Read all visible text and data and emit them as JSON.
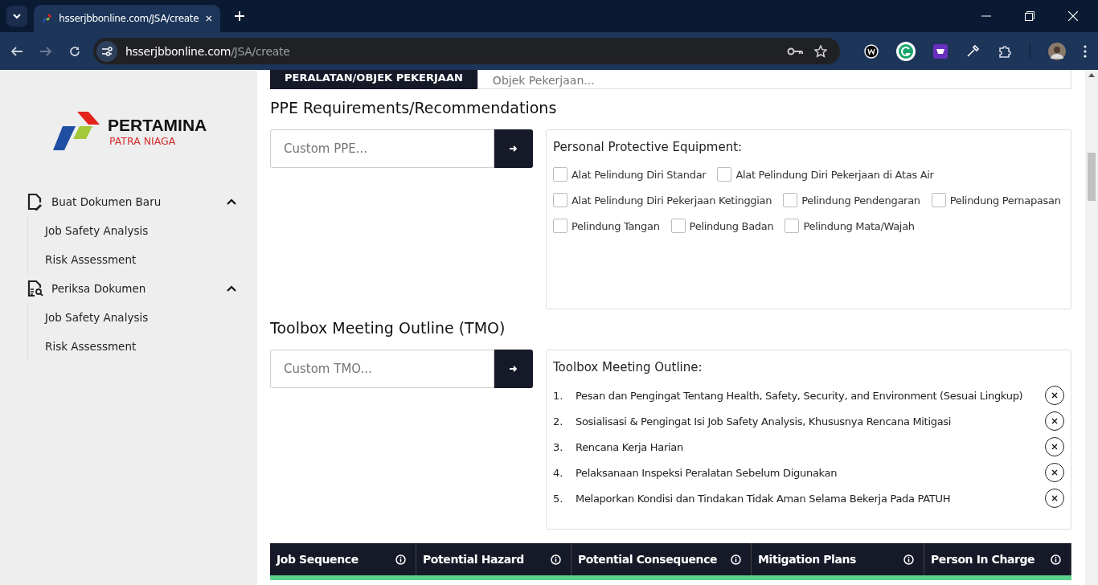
{
  "browser": {
    "tabs": [
      {
        "title": "hsserjbbonline.com/JSA/create",
        "selected": true
      }
    ],
    "address": {
      "host": "hsserjbbonline.com",
      "path": "/JSA/create"
    }
  },
  "sidebar": {
    "logo": {
      "name": "PERTAMINA",
      "subtitle": "PATRA NIAGA"
    },
    "groups": [
      {
        "label": "Buat Dokumen Baru",
        "kind": "new-document",
        "expanded": true,
        "children": [
          {
            "label": "Job Safety Analysis"
          },
          {
            "label": "Risk Assessment"
          }
        ]
      },
      {
        "label": "Periksa Dokumen",
        "kind": "review-document",
        "expanded": true,
        "children": [
          {
            "label": "Job Safety Analysis"
          },
          {
            "label": "Risk Assessment"
          }
        ]
      }
    ]
  },
  "top_row": {
    "label": "PERALATAN/OBJEK PEKERJAAN",
    "placeholder": "Objek Pekerjaan..."
  },
  "ppe": {
    "title": "PPE Requirements/Recommendations",
    "placeholder": "Custom PPE...",
    "card_title": "Personal Protective Equipment:",
    "items": [
      {
        "label": "Alat Pelindung Diri Standar",
        "checked": false
      },
      {
        "label": "Alat Pelindung Diri Pekerjaan di Atas Air",
        "checked": false
      },
      {
        "label": "Alat Pelindung Diri Pekerjaan Ketinggian",
        "checked": false
      },
      {
        "label": "Pelindung Pendengaran",
        "checked": false
      },
      {
        "label": "Pelindung Pernapasan",
        "checked": false
      },
      {
        "label": "Pelindung Tangan",
        "checked": false
      },
      {
        "label": "Pelindung Badan",
        "checked": false
      },
      {
        "label": "Pelindung Mata/Wajah",
        "checked": false
      }
    ]
  },
  "tmo": {
    "title": "Toolbox Meeting Outline (TMO)",
    "placeholder": "Custom TMO...",
    "card_title": "Toolbox Meeting Outline:",
    "items": [
      {
        "number": "1.",
        "text": "Pesan dan Pengingat Tentang Health, Safety, Security, and Environment (Sesuai Lingkup)"
      },
      {
        "number": "2.",
        "text": "Sosialisasi & Pengingat Isi Job Safety Analysis, Khususnya Rencana Mitigasi"
      },
      {
        "number": "3.",
        "text": "Rencana Kerja Harian"
      },
      {
        "number": "4.",
        "text": "Pelaksanaan Inspeksi Peralatan Sebelum Digunakan"
      },
      {
        "number": "5.",
        "text": "Melaporkan Kondisi dan Tindakan Tidak Aman Selama Bekerja Pada PATUH"
      }
    ]
  },
  "table": {
    "columns": [
      "Job Sequence",
      "Potential Hazard",
      "Potential Consequence",
      "Mitigation Plans",
      "Person In Charge"
    ]
  }
}
